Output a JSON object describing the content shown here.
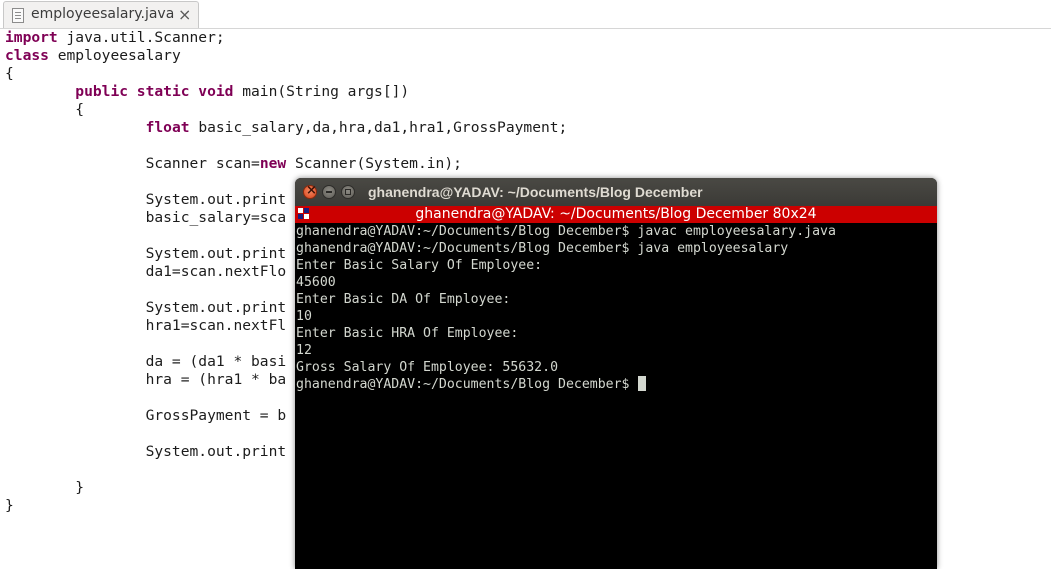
{
  "editor": {
    "tab": {
      "title": "employeesalary.java",
      "close_symbol": "×"
    },
    "code_lines": [
      [
        {
          "t": "import",
          "k": true
        },
        {
          "t": " java.util.Scanner;"
        }
      ],
      [
        {
          "t": "class",
          "k": true
        },
        {
          "t": " employeesalary"
        }
      ],
      [
        {
          "t": "{"
        }
      ],
      [
        {
          "t": "        "
        },
        {
          "t": "public static void",
          "k": true
        },
        {
          "t": " main(String args[])"
        }
      ],
      [
        {
          "t": "        {"
        }
      ],
      [
        {
          "t": "                "
        },
        {
          "t": "float",
          "k": true
        },
        {
          "t": " basic_salary,da,hra,da1,hra1,GrossPayment;"
        }
      ],
      [
        {
          "t": ""
        }
      ],
      [
        {
          "t": "                Scanner scan="
        },
        {
          "t": "new",
          "k": true
        },
        {
          "t": " Scanner(System.in);"
        }
      ],
      [
        {
          "t": ""
        }
      ],
      [
        {
          "t": "                System.out.print"
        }
      ],
      [
        {
          "t": "                basic_salary=sca"
        }
      ],
      [
        {
          "t": ""
        }
      ],
      [
        {
          "t": "                System.out.print"
        }
      ],
      [
        {
          "t": "                da1=scan.nextFlo"
        }
      ],
      [
        {
          "t": ""
        }
      ],
      [
        {
          "t": "                System.out.print"
        }
      ],
      [
        {
          "t": "                hra1=scan.nextFl"
        }
      ],
      [
        {
          "t": ""
        }
      ],
      [
        {
          "t": "                da = (da1 * basi"
        }
      ],
      [
        {
          "t": "                hra = (hra1 * ba"
        }
      ],
      [
        {
          "t": ""
        }
      ],
      [
        {
          "t": "                GrossPayment = b"
        }
      ],
      [
        {
          "t": ""
        }
      ],
      [
        {
          "t": "                System.out.print"
        }
      ],
      [
        {
          "t": ""
        }
      ],
      [
        {
          "t": "        }"
        }
      ],
      [
        {
          "t": "}"
        }
      ]
    ],
    "colors": {
      "keyword": "#7f0055",
      "text": "#1c1c1c"
    }
  },
  "terminal": {
    "window_title": "ghanendra@YADAV: ~/Documents/Blog December",
    "tab_title": "ghanendra@YADAV: ~/Documents/Blog December 80x24",
    "lines": [
      "ghanendra@YADAV:~/Documents/Blog December$ javac employeesalary.java",
      "ghanendra@YADAV:~/Documents/Blog December$ java employeesalary",
      "Enter Basic Salary Of Employee:",
      "45600",
      "Enter Basic DA Of Employee:",
      "10",
      "Enter Basic HRA Of Employee:",
      "12",
      "Gross Salary Of Employee: 55632.0",
      "ghanendra@YADAV:~/Documents/Blog December$ "
    ],
    "colors": {
      "background": "#000000",
      "text": "#d3d7cf",
      "title_bar": "#cc0000"
    }
  }
}
